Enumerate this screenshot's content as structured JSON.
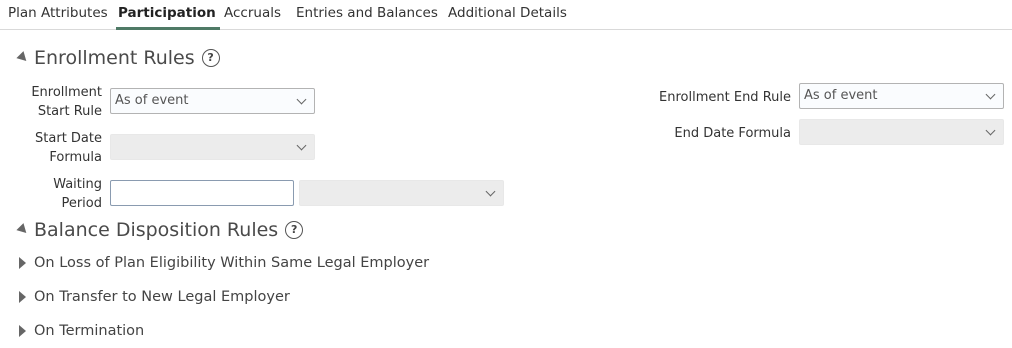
{
  "tabs": [
    {
      "label": "Plan Attributes"
    },
    {
      "label": "Participation"
    },
    {
      "label": "Accruals"
    },
    {
      "label": "Entries and Balances"
    },
    {
      "label": "Additional Details"
    }
  ],
  "active_tab": "Participation",
  "accent_color": "#4f7a66",
  "enrollment_rules": {
    "title": "Enrollment Rules",
    "enrollment_start_rule": {
      "label_line1": "Enrollment",
      "label_line2": "Start Rule",
      "value": "As of event"
    },
    "start_date_formula": {
      "label_line1": "Start Date",
      "label_line2": "Formula",
      "value": ""
    },
    "waiting_period": {
      "label_line1": "Waiting",
      "label_line2": "Period",
      "value": "",
      "unit_value": ""
    },
    "enrollment_end_rule": {
      "label": "Enrollment End Rule",
      "value": "As of event"
    },
    "end_date_formula": {
      "label": "End Date Formula",
      "value": ""
    }
  },
  "balance_disposition_rules": {
    "title": "Balance Disposition Rules",
    "subsections": [
      {
        "title": "On Loss of Plan Eligibility Within Same Legal Employer"
      },
      {
        "title": "On Transfer to New Legal Employer"
      },
      {
        "title": "On Termination"
      }
    ]
  },
  "icons": {
    "help": "?"
  }
}
